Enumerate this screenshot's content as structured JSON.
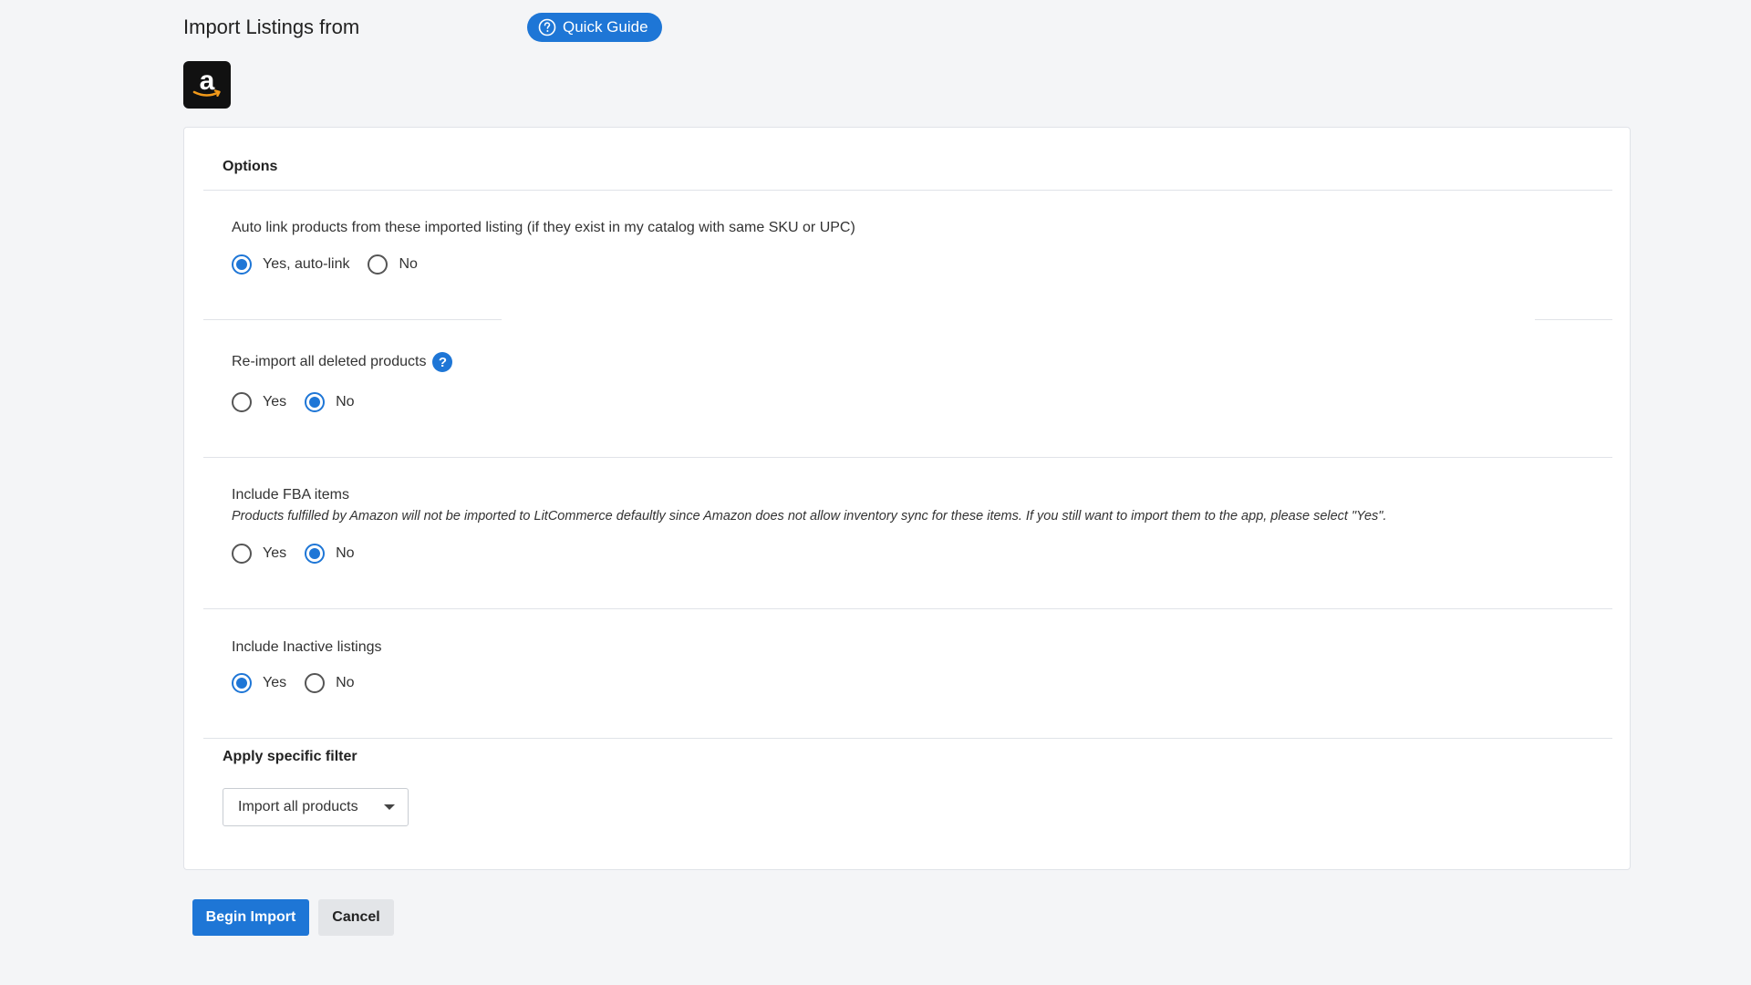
{
  "header": {
    "title": "Import Listings from",
    "guide_label": "Quick Guide",
    "logo_letter": "a"
  },
  "options": {
    "heading": "Options",
    "auto_link": {
      "label": "Auto link products from these imported listing (if they exist in my catalog with same SKU or UPC)",
      "options": [
        "Yes, auto-link",
        "No"
      ],
      "selected": "Yes, auto-link"
    },
    "reimport": {
      "label": "Re-import all deleted products",
      "help": "?",
      "options": [
        "Yes",
        "No"
      ],
      "selected": "No"
    },
    "fba": {
      "label": "Include FBA items",
      "note": "Products fulfilled by Amazon will not be imported to LitCommerce defaultly since Amazon does not allow inventory sync for these items. If you still want to import them to the app, please select \"Yes\".",
      "options": [
        "Yes",
        "No"
      ],
      "selected": "No"
    },
    "inactive": {
      "label": "Include Inactive listings",
      "options": [
        "Yes",
        "No"
      ],
      "selected": "Yes"
    }
  },
  "filter": {
    "heading": "Apply specific filter",
    "selected": "Import all products"
  },
  "actions": {
    "begin": "Begin Import",
    "cancel": "Cancel"
  },
  "colors": {
    "accent": "#1e76d6",
    "background": "#f4f5f7"
  }
}
